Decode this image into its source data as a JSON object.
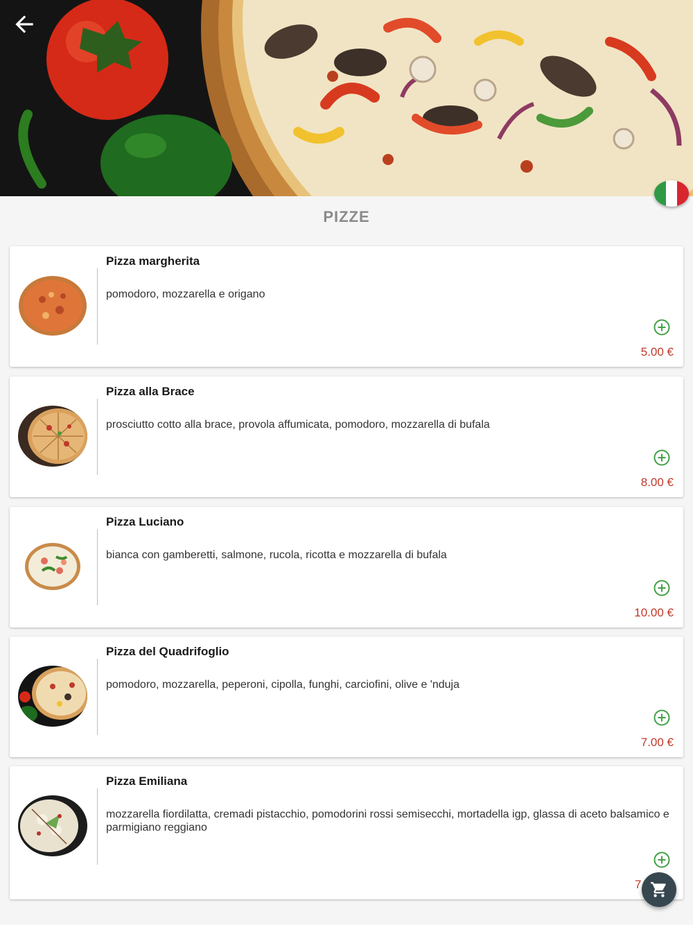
{
  "header": {
    "back_icon": "arrow-left-icon",
    "language_flag": "italy-flag-icon"
  },
  "section": {
    "title": "PIZZE"
  },
  "products": [
    {
      "name": "Pizza margherita",
      "description": "pomodoro, mozzarella e origano",
      "price": "5.00 €"
    },
    {
      "name": "Pizza alla Brace",
      "description": "prosciutto cotto alla brace, provola affumicata, pomodoro, mozzarella di bufala",
      "price": "8.00 €"
    },
    {
      "name": "Pizza Luciano",
      "description": "bianca con gamberetti, salmone, rucola, ricotta e mozzarella di bufala",
      "price": "10.00 €"
    },
    {
      "name": "Pizza del Quadrifoglio",
      "description": "pomodoro, mozzarella, peperoni, cipolla, funghi, carciofini, olive e 'nduja",
      "price": "7.00 €"
    },
    {
      "name": "Pizza Emiliana",
      "description": "mozzarella fiordilatta, cremadi pistacchio, pomodorini rossi semisecchi, mortadella igp, glassa di aceto balsamico e parmigiano reggiano",
      "price": "7"
    }
  ],
  "colors": {
    "price": "#c0392b",
    "add_icon": "#43a047",
    "fab": "#37474f"
  },
  "cart_icon": "shopping-cart-icon",
  "add_icon": "plus-circle-icon"
}
